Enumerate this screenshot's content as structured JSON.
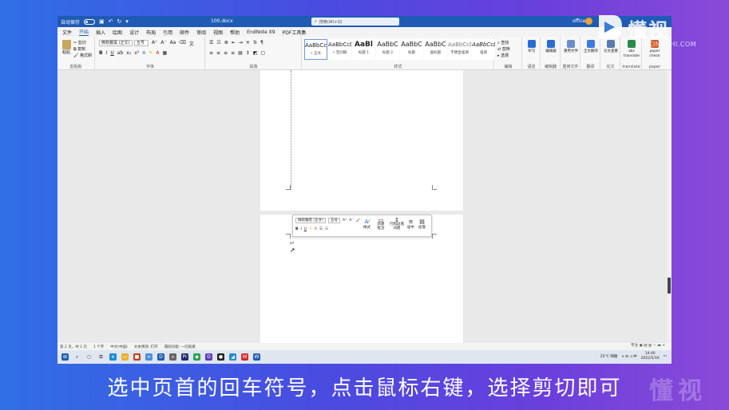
{
  "titlebar": {
    "autosave_label": "自动保存",
    "doc_title": "100.docx",
    "search_placeholder": "搜索(Alt+Q)",
    "account": "office"
  },
  "menu_tabs": [
    "文件",
    "开始",
    "插入",
    "绘图",
    "设计",
    "布局",
    "引用",
    "邮件",
    "审阅",
    "视图",
    "帮助",
    "EndNote X9",
    "PDF工具集"
  ],
  "ribbon": {
    "clipboard": {
      "paste": "粘贴",
      "cut": "剪切",
      "copy": "复制",
      "painter": "格式刷",
      "label": "剪贴板"
    },
    "font": {
      "name": "微软雅黑 (正文)",
      "size": "五号",
      "label": "字体"
    },
    "paragraph": {
      "label": "段落"
    },
    "styles": [
      {
        "preview": "AaBbCcDi",
        "name": "• 正文"
      },
      {
        "preview": "AaBbCcDi",
        "name": "• 无间隔"
      },
      {
        "preview": "AaBl",
        "name": "标题 1"
      },
      {
        "preview": "AaBbC",
        "name": "标题 2"
      },
      {
        "preview": "AaBbC",
        "name": "标题"
      },
      {
        "preview": "AaBbC",
        "name": "副标题"
      },
      {
        "preview": "AaBbCcDi",
        "name": "不明显强调"
      },
      {
        "preview": "AaBbCcD",
        "name": "强调"
      }
    ],
    "styles_label": "样式",
    "editing": {
      "find": "查找",
      "replace": "替换",
      "select": "选择",
      "label": "编辑"
    },
    "voice": {
      "dictate": "听写",
      "label": "语音"
    },
    "editor": {
      "name": "编辑器",
      "label": "编辑器"
    },
    "reuse": {
      "name": "重用文件",
      "label": "重用文件"
    },
    "translate": {
      "name": "全文翻译",
      "label": "翻译"
    },
    "thesis": {
      "name": "论文查重",
      "label": "论文"
    },
    "abc": {
      "name": "abc translate",
      "label": "translate"
    },
    "paper": {
      "name": "paper check",
      "label": "paper"
    }
  },
  "mini_toolbar": {
    "font": "微软雅黑 (正文)",
    "size": "五号",
    "styles_label": "样式",
    "new_comment": "新建批注",
    "line_spacing": "行和段落间距",
    "center": "居中",
    "indent": "段落"
  },
  "status": {
    "page": "第 2 页，共 2 页",
    "words": "1 个字",
    "lang": "中文(中国)",
    "predict": "文本预测: 打开",
    "accessibility": "辅助功能: 一切就绪",
    "focus": "专注"
  },
  "taskbar": {
    "weather": "25°C 晴朗",
    "time": "14:40",
    "date": "2022/5/16"
  },
  "watermark": {
    "brand": "懂视",
    "domain": "51DONGSHI.COM"
  },
  "caption": "选中页首的回车符号，点击鼠标右键，选择剪切即可"
}
